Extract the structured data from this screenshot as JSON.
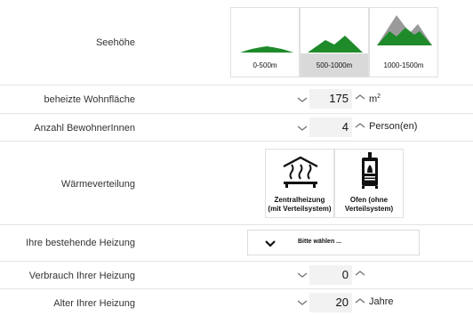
{
  "altitude": {
    "label": "Seehöhe",
    "options": [
      {
        "label": "0-500m",
        "icon": "low-hill-icon",
        "selected": false
      },
      {
        "label": "500-1000m",
        "icon": "mid-mountain-icon",
        "selected": true
      },
      {
        "label": "1000-1500m",
        "icon": "high-mountain-icon",
        "selected": false
      }
    ]
  },
  "area": {
    "label": "beheizte Wohnfläche",
    "value": "175",
    "unit": "m",
    "unit_sup": "2"
  },
  "residents": {
    "label": "Anzahl BewohnerInnen",
    "value": "4",
    "unit": "Person(en)"
  },
  "distribution": {
    "label": "Wärmeverteilung",
    "options": [
      {
        "label_line1": "Zentralheizung",
        "label_line2": "(mit Verteilsystem)",
        "icon": "radiator-heat-icon"
      },
      {
        "label_line1": "Ofen (ohne",
        "label_line2": "Verteilsystem)",
        "icon": "stove-icon"
      }
    ]
  },
  "heating": {
    "label": "Ihre bestehende Heizung",
    "placeholder": "Bitte wählen ..."
  },
  "consumption": {
    "label": "Verbrauch Ihrer Heizung",
    "value": "0"
  },
  "age": {
    "label": "Alter Ihrer Heizung",
    "value": "20",
    "unit": "Jahre"
  },
  "colors": {
    "mountain_green": "#1e8a2a",
    "mountain_grey": "#9a9a9a",
    "selected_bg": "#d9d9d9"
  }
}
